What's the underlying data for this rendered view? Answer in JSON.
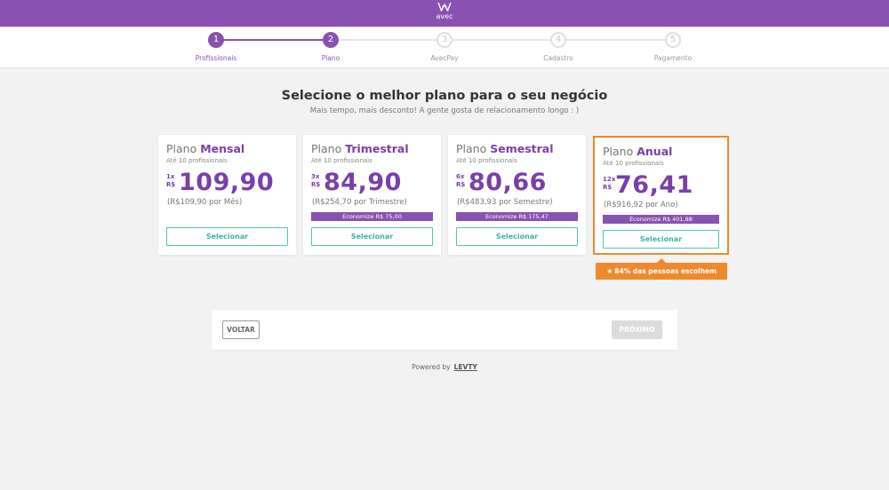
{
  "header": {
    "logo_text": "avec",
    "brand_color": "#8a52b0"
  },
  "steps": [
    {
      "number": "1",
      "label": "Profissionais",
      "state": "done"
    },
    {
      "number": "2",
      "label": "Plano",
      "state": "done"
    },
    {
      "number": "3",
      "label": "AvecPay",
      "state": "todo"
    },
    {
      "number": "4",
      "label": "Cadastro",
      "state": "todo"
    },
    {
      "number": "5",
      "label": "Pagamento",
      "state": "todo"
    }
  ],
  "main": {
    "headline": "Selecione o melhor plano para o seu negócio",
    "subhead": "Mais tempo, mais desconto! A gente gosta de relacionamento longo : )"
  },
  "plans": [
    {
      "title_prefix": "Plano",
      "name": "Mensal",
      "limit": "Até 10 profissionais",
      "installments": "1x",
      "currency": "R$",
      "price": "109,90",
      "period": "(R$109,90 por Mês)",
      "savings": "",
      "button": "Selecionar"
    },
    {
      "title_prefix": "Plano",
      "name": "Trimestral",
      "limit": "Até 10 profissionais",
      "installments": "3x",
      "currency": "R$",
      "price": "84,90",
      "period": "(R$254,70 por Trimestre)",
      "savings": "Economize R$ 75,00",
      "button": "Selecionar"
    },
    {
      "title_prefix": "Plano",
      "name": "Semestral",
      "limit": "Até 10 profissionais",
      "installments": "6x",
      "currency": "R$",
      "price": "80,66",
      "period": "(R$483,93 por Semestre)",
      "savings": "Economize R$ 175,47",
      "button": "Selecionar"
    },
    {
      "title_prefix": "Plano",
      "name": "Anual",
      "limit": "Até 10 profissionais",
      "installments": "12x",
      "currency": "R$",
      "price": "76,41",
      "period": "(R$916,92 por Ano)",
      "savings": "Economize R$ 401,88",
      "button": "Selecionar"
    }
  ],
  "popular": {
    "icon": "star-icon",
    "text": "84% das pessoas escolhem",
    "color": "#f0892c"
  },
  "navigation": {
    "back_label": "VOLTAR",
    "next_label": "PRÓXIMO"
  },
  "footer": {
    "powered_by": "Powered by",
    "brand": "LEVTY"
  }
}
